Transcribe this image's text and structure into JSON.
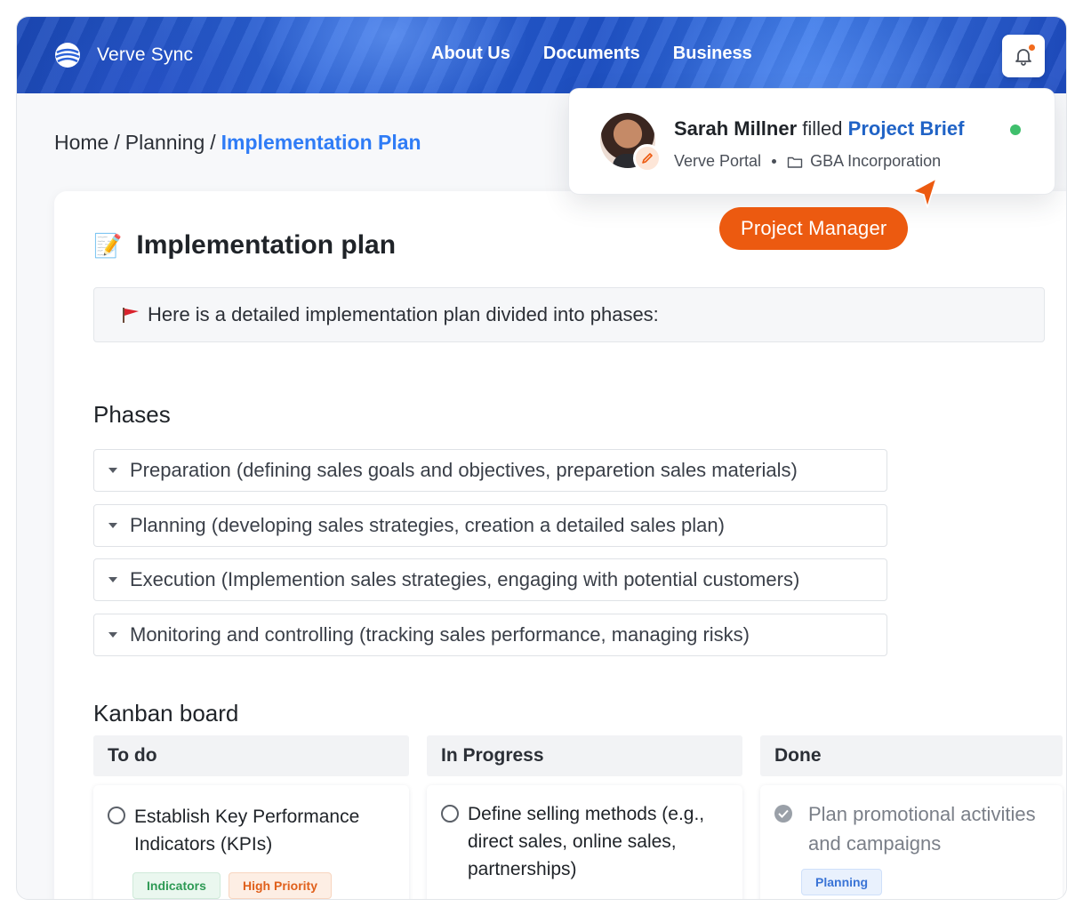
{
  "header": {
    "brand": "Verve Sync",
    "nav": [
      "About Us",
      "Documents",
      "Business"
    ],
    "notification_icon": "bell-icon",
    "colors": {
      "brand_blue": "#2c63d8",
      "accent_orange": "#ec5a10",
      "link_blue": "#2f7cf6"
    }
  },
  "breadcrumb": {
    "items": [
      "Home",
      "Planning"
    ],
    "current": "Implementation Plan",
    "separator": "/"
  },
  "notification": {
    "user": "Sarah Millner",
    "action": "filled",
    "document": "Project Brief",
    "source": "Verve Portal",
    "workspace": "GBA Incorporation",
    "status": "online",
    "role": "Project Manager"
  },
  "page": {
    "title_emoji": "📝",
    "title": "Implementation plan",
    "callout_icon": "🚩",
    "callout": "Here is a detailed  implementation plan divided into phases:"
  },
  "phases": {
    "title": "Phases",
    "items": [
      "Preparation (defining sales goals and objectives, preparetion sales materials)",
      "Planning (developing sales strategies, creation a detailed sales plan)",
      "Execution (Implemention sales strategies, engaging with potential customers)",
      "Monitoring and controlling (tracking sales performance, managing risks)"
    ]
  },
  "kanban": {
    "title": "Kanban board",
    "columns": [
      {
        "name": "To do",
        "cards": [
          {
            "text": "Establish Key Performance Indicators (KPIs)",
            "done": false,
            "tags": [
              "Indicators",
              "High Priority"
            ]
          }
        ]
      },
      {
        "name": "In Progress",
        "cards": [
          {
            "text": "Define selling methods (e.g., direct sales, online sales, partnerships)",
            "done": false,
            "tags": []
          }
        ]
      },
      {
        "name": "Done",
        "cards": [
          {
            "text": "Plan promotional activities and campaigns",
            "done": true,
            "tags": [
              "Planning"
            ]
          }
        ]
      }
    ]
  }
}
